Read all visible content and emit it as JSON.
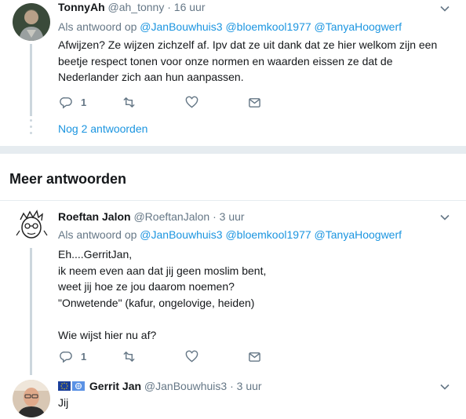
{
  "tweet1": {
    "name": "TonnyAh",
    "handle": "@ah_tonny",
    "separator": "·",
    "time": "16 uur",
    "reply_prefix": "Als antwoord op",
    "mentions": [
      "@JanBouwhuis3",
      "@bloemkool1977",
      "@TanyaHoogwerf"
    ],
    "text_lines": [
      "Afwijzen? Ze wijzen zichzelf af. Ipv dat ze uit dank dat ze hier welkom zijn een",
      "beetje respect tonen voor onze normen en waarden eissen ze dat de",
      "Nederlander zich aan hun aanpassen."
    ],
    "reply_count": "1",
    "more_replies": "Nog 2 antwoorden"
  },
  "section": {
    "title": "Meer antwoorden"
  },
  "tweet2": {
    "name": "Roeftan Jalon",
    "handle": "@RoeftanJalon",
    "separator": "·",
    "time": "3 uur",
    "reply_prefix": "Als antwoord op",
    "mentions": [
      "@JanBouwhuis3",
      "@bloemkool1977",
      "@TanyaHoogwerf"
    ],
    "text_lines": [
      "Eh....GerritJan,",
      "ik neem even aan dat jij geen moslim bent,",
      "weet jij hoe ze jou daarom noemen?",
      "\"Onwetende\" (kafur, ongelovige, heiden)",
      "",
      "Wie wijst hier nu af?"
    ],
    "reply_count": "1"
  },
  "tweet3": {
    "name": "Gerrit Jan",
    "handle": "@JanBouwhuis3",
    "separator": "·",
    "time": "3 uur",
    "text": "Jij"
  },
  "colors": {
    "link": "#1b95e0",
    "muted": "#657786",
    "divider": "#e6ecf0",
    "thread": "#ccd6dd"
  },
  "icons": [
    "reply-icon",
    "retweet-icon",
    "like-icon",
    "message-icon",
    "chevron-down-icon",
    "eu-flag-icon",
    "un-flag-icon"
  ]
}
